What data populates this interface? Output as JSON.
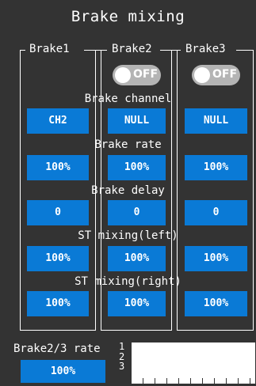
{
  "title": "Brake mixing",
  "columns": [
    {
      "label": "Brake1"
    },
    {
      "label": "Brake2",
      "toggle": "OFF"
    },
    {
      "label": "Brake3",
      "toggle": "OFF"
    }
  ],
  "rows": [
    {
      "label": "Brake channel",
      "values": [
        "CH2",
        "NULL",
        "NULL"
      ]
    },
    {
      "label": "Brake rate",
      "values": [
        "100%",
        "100%",
        "100%"
      ]
    },
    {
      "label": "Brake delay",
      "values": [
        "0",
        "0",
        "0"
      ]
    },
    {
      "label": "ST mixing(left)",
      "values": [
        "100%",
        "100%",
        "100%"
      ]
    },
    {
      "label": "ST mixing(right)",
      "values": [
        "100%",
        "100%",
        "100%"
      ]
    }
  ],
  "bottom": {
    "rate_label": "Brake2/3 rate",
    "rate_value": "100%",
    "graph_labels": [
      "1",
      "2",
      "3"
    ]
  },
  "colors": {
    "background": "#333333",
    "accent": "#0a7ad6",
    "toggle_off": "#b4b4b4"
  }
}
